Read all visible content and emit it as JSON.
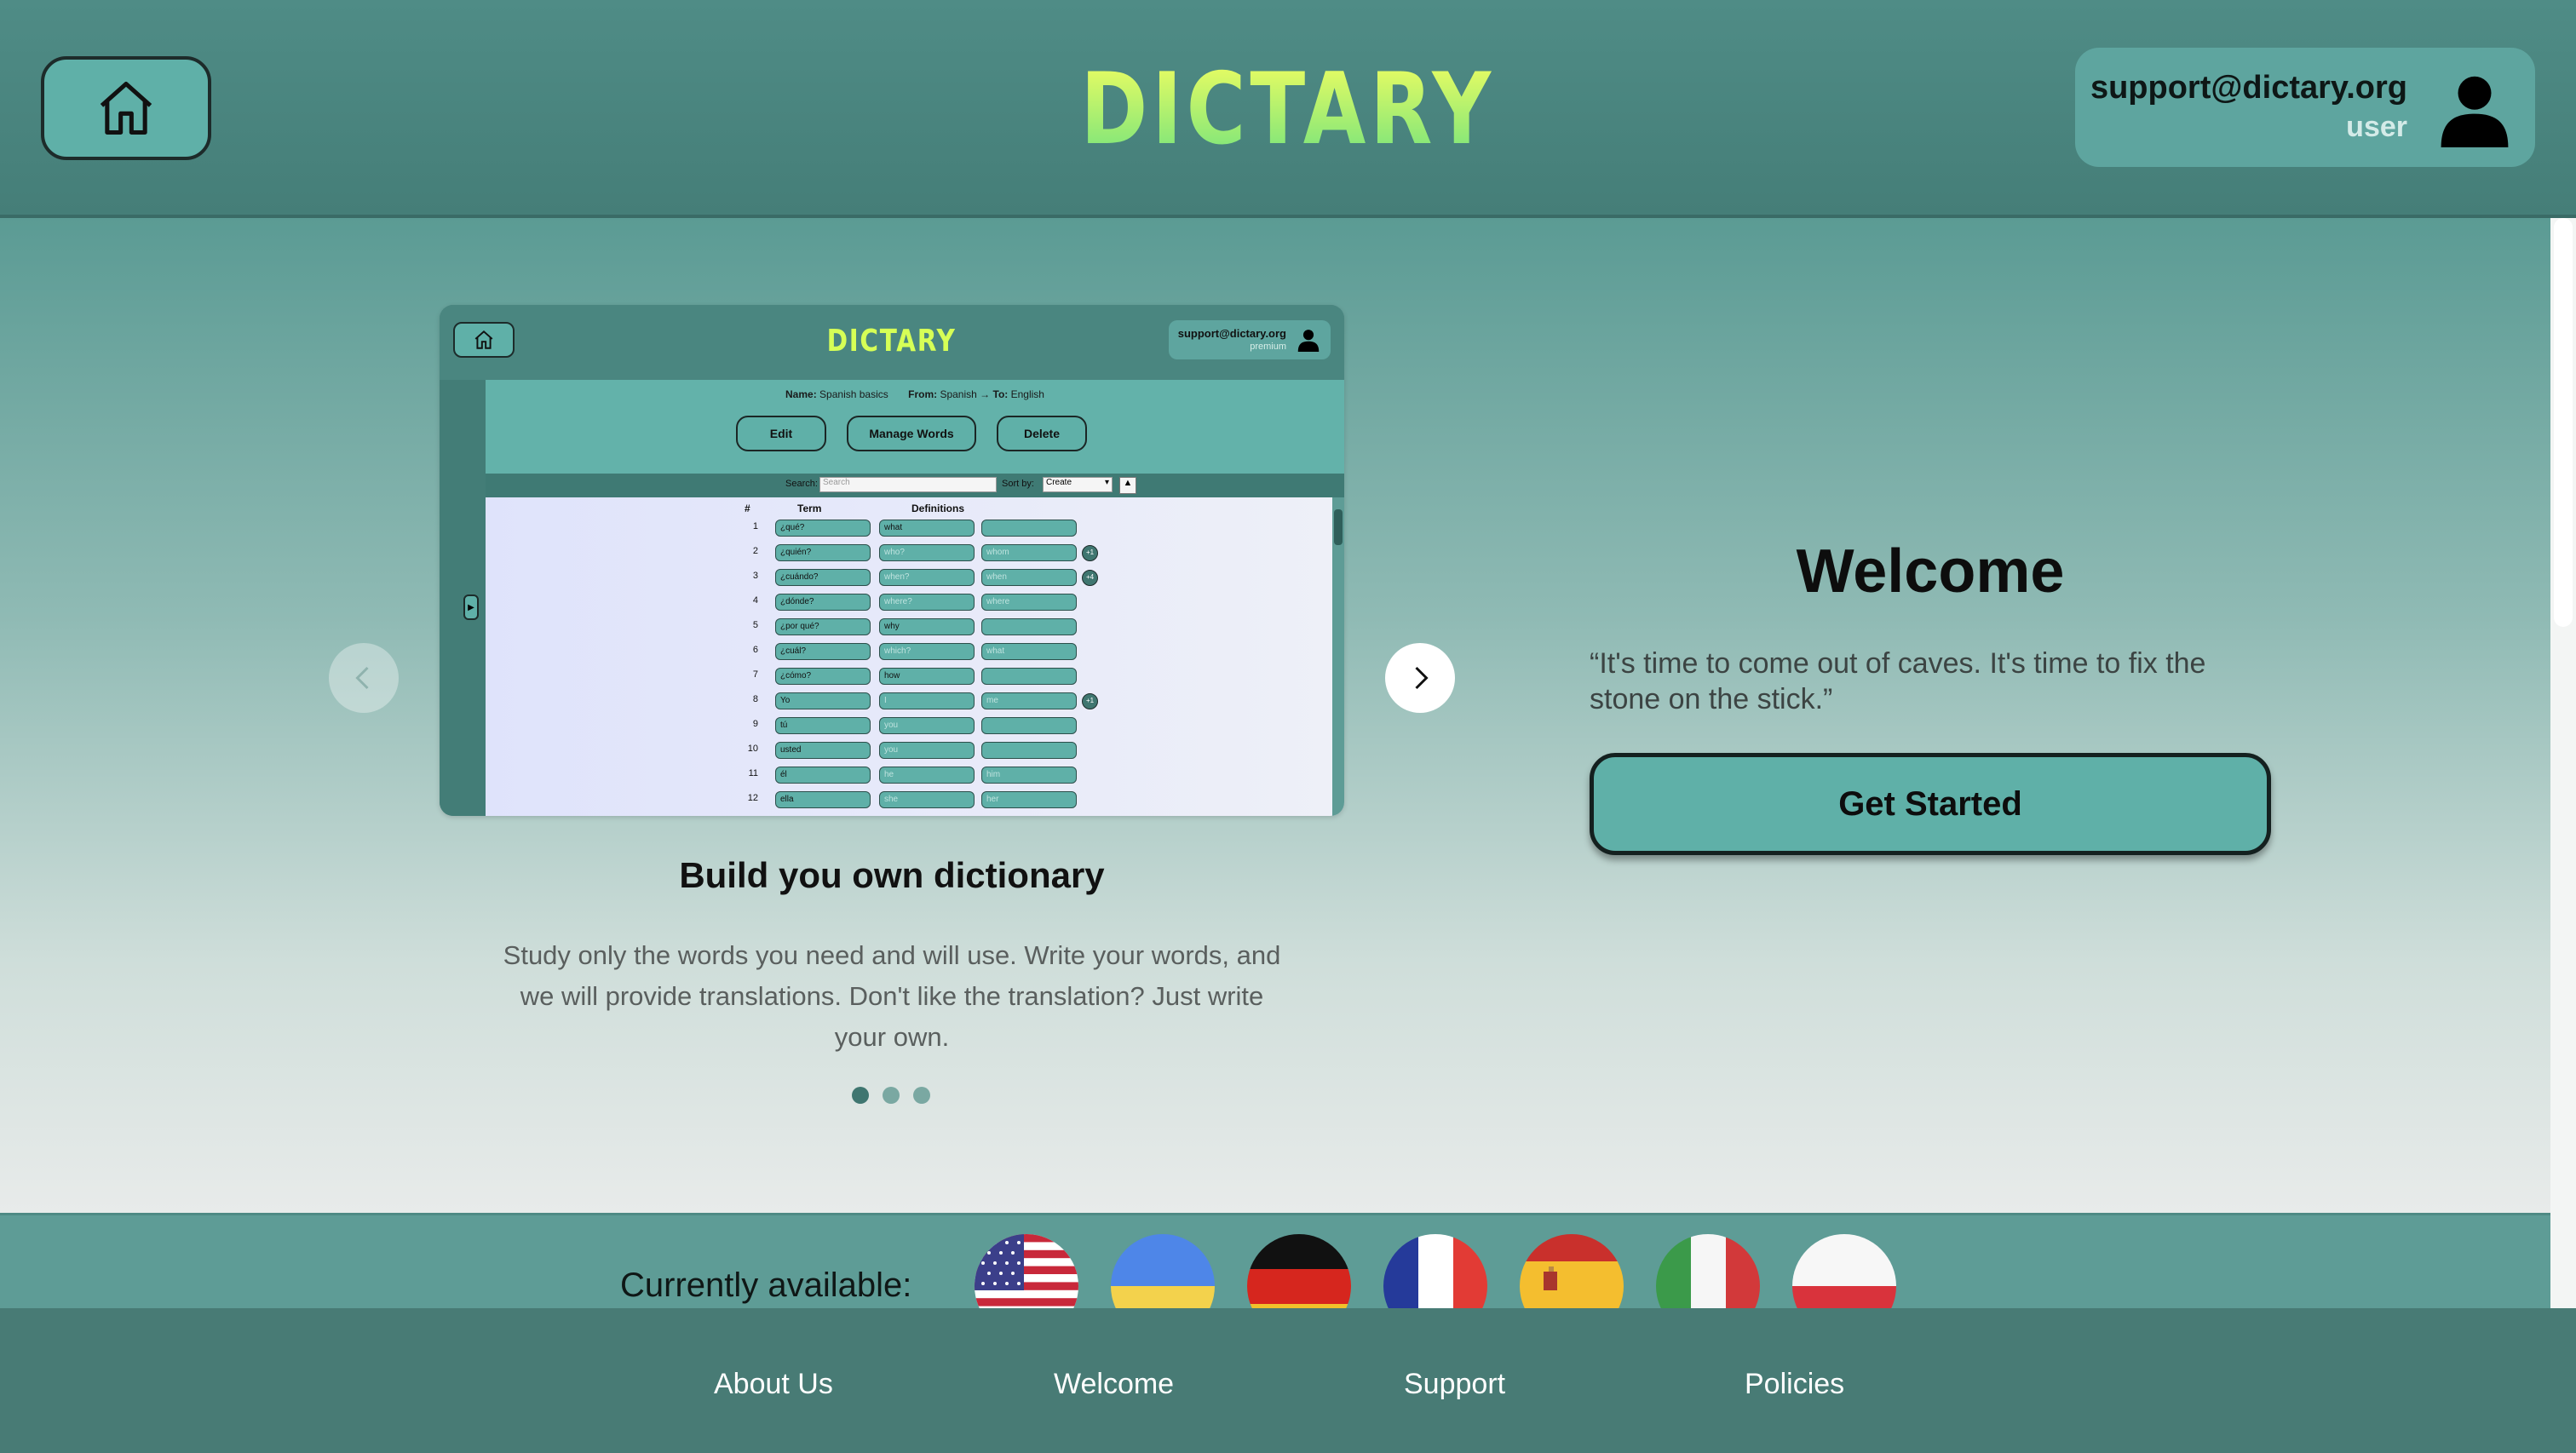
{
  "header": {
    "logo_text": "DICTARY",
    "user_email": "support@dictary.org",
    "user_role": "user"
  },
  "carousel": {
    "slide_title": "Build you own dictionary",
    "slide_description": "Study only the words you need and will use. Write your words, and we will provide translations. Don't like the translation? Just write your own.",
    "dots_count": 3,
    "active_dot": 1,
    "preview": {
      "logo_text": "DICTARY",
      "user_email": "support@dictary.org",
      "user_role": "premium",
      "info_name_label": "Name:",
      "info_name": "Spanish basics",
      "info_from_label": "From:",
      "info_from": "Spanish",
      "info_to_label": "To:",
      "info_to": "English",
      "buttons": [
        "Edit",
        "Manage Words",
        "Delete"
      ],
      "search_label": "Search:",
      "search_placeholder": "Search",
      "sort_label": "Sort by:",
      "sort_value": "Create",
      "columns": {
        "num": "#",
        "term": "Term",
        "definitions": "Definitions"
      },
      "rows": [
        {
          "n": "1",
          "term": "¿qué?",
          "d1": "what",
          "d2": "",
          "d1_ph": false,
          "d2_ph": true,
          "plus": ""
        },
        {
          "n": "2",
          "term": "¿quién?",
          "d1": "who?",
          "d2": "whom",
          "d1_ph": true,
          "d2_ph": true,
          "plus": "+1"
        },
        {
          "n": "3",
          "term": "¿cuándo?",
          "d1": "when?",
          "d2": "when",
          "d1_ph": true,
          "d2_ph": true,
          "plus": "+4"
        },
        {
          "n": "4",
          "term": "¿dónde?",
          "d1": "where?",
          "d2": "where",
          "d1_ph": true,
          "d2_ph": true,
          "plus": ""
        },
        {
          "n": "5",
          "term": "¿por qué?",
          "d1": "why",
          "d2": "",
          "d1_ph": false,
          "d2_ph": true,
          "plus": ""
        },
        {
          "n": "6",
          "term": "¿cuál?",
          "d1": "which?",
          "d2": "what",
          "d1_ph": true,
          "d2_ph": true,
          "plus": ""
        },
        {
          "n": "7",
          "term": "¿cómo?",
          "d1": "how",
          "d2": "",
          "d1_ph": false,
          "d2_ph": true,
          "plus": ""
        },
        {
          "n": "8",
          "term": "Yo",
          "d1": "I",
          "d2": "me",
          "d1_ph": true,
          "d2_ph": true,
          "plus": "+1"
        },
        {
          "n": "9",
          "term": "tú",
          "d1": "you",
          "d2": "",
          "d1_ph": true,
          "d2_ph": true,
          "plus": ""
        },
        {
          "n": "10",
          "term": "usted",
          "d1": "you",
          "d2": "",
          "d1_ph": true,
          "d2_ph": true,
          "plus": ""
        },
        {
          "n": "11",
          "term": "él",
          "d1": "he",
          "d2": "him",
          "d1_ph": true,
          "d2_ph": true,
          "plus": ""
        },
        {
          "n": "12",
          "term": "ella",
          "d1": "she",
          "d2": "her",
          "d1_ph": true,
          "d2_ph": true,
          "plus": ""
        }
      ]
    }
  },
  "welcome": {
    "title": "Welcome",
    "quote": "“It's time to come out of caves. It's time to fix the stone on the stick.”",
    "cta_label": "Get Started"
  },
  "languages": {
    "label": "Currently available:",
    "flags": [
      "united-states-flag",
      "ukraine-flag",
      "germany-flag",
      "france-flag",
      "spain-flag",
      "italy-flag",
      "poland-flag"
    ]
  },
  "footer": {
    "links": [
      "About Us",
      "Welcome",
      "Support",
      "Policies"
    ]
  },
  "colors": {
    "header_bg": "#4f8c86",
    "accent": "#5fb0a8",
    "footer_bg": "#487b75",
    "logo_gradient_top": "#f6ff5f",
    "logo_gradient_bottom": "#6fe27e"
  }
}
